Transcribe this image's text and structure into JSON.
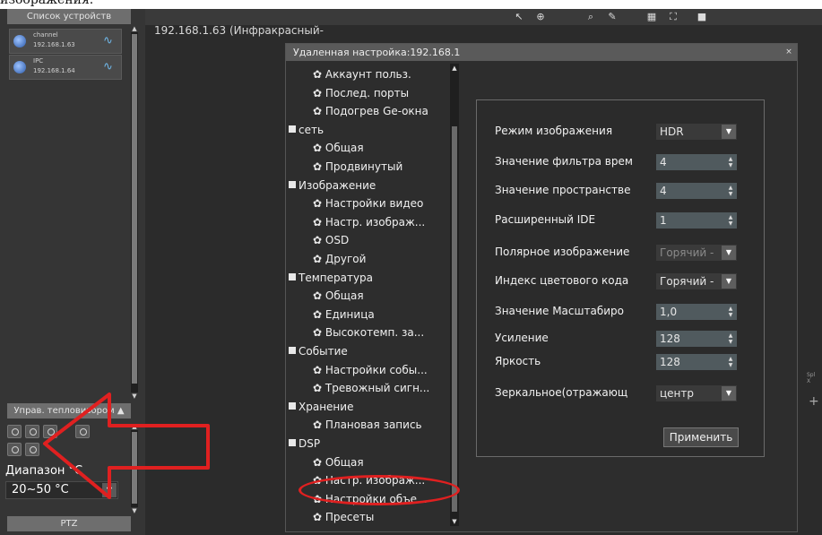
{
  "caption_fragment": "изображения.",
  "device_list": {
    "header": "Список устройств",
    "devices": [
      {
        "name": "channel",
        "ip": "192.168.1.63"
      },
      {
        "name": "IPC",
        "ip": "192.168.1.64"
      }
    ]
  },
  "thermal_panel": {
    "header": "Управ. тепловизором ▲",
    "range_label": "Диапазон °С",
    "range_value": "20~50 °С",
    "ptz_header": "PTZ"
  },
  "video": {
    "title": "192.168.1.63 (Инфракрасный-",
    "overlay_text": "Spl\nX"
  },
  "dialog": {
    "title": "Удаленная настройка:192.168.1",
    "close": "×",
    "tree": [
      {
        "label": "Аккаунт польз.",
        "level": 1
      },
      {
        "label": "Послед. порты",
        "level": 1
      },
      {
        "label": "Подогрев Ge-окна",
        "level": 1
      },
      {
        "label": "сеть",
        "level": 0
      },
      {
        "label": "Общая",
        "level": 1
      },
      {
        "label": "Продвинутый",
        "level": 1
      },
      {
        "label": "Изображение",
        "level": 0
      },
      {
        "label": "Настройки видео",
        "level": 1
      },
      {
        "label": "Настр. изображ...",
        "level": 1
      },
      {
        "label": "OSD",
        "level": 1
      },
      {
        "label": "Другой",
        "level": 1
      },
      {
        "label": "Температура",
        "level": 0
      },
      {
        "label": "Общая",
        "level": 1
      },
      {
        "label": "Единица",
        "level": 1
      },
      {
        "label": "Высокотемп. за...",
        "level": 1
      },
      {
        "label": "Событие",
        "level": 0
      },
      {
        "label": "Настройки собы...",
        "level": 1
      },
      {
        "label": "Тревожный сигн...",
        "level": 1
      },
      {
        "label": "Хранение",
        "level": 0
      },
      {
        "label": "Плановая запись",
        "level": 1
      },
      {
        "label": "DSP",
        "level": 0
      },
      {
        "label": "Общая",
        "level": 1
      },
      {
        "label": "Настр. изображ...",
        "level": 1
      },
      {
        "label": "Настройки объе...",
        "level": 1
      },
      {
        "label": "Пресеты",
        "level": 1
      }
    ],
    "form": {
      "fields": [
        {
          "label": "Режим изображения",
          "value": "HDR",
          "kind": "select"
        },
        {
          "label": "Значение фильтра врем",
          "value": "4",
          "kind": "spin"
        },
        {
          "label": "Значение пространстве",
          "value": "4",
          "kind": "spin"
        },
        {
          "label": "Расширенный IDE",
          "value": "1",
          "kind": "spin"
        },
        {
          "label": "Полярное изображение",
          "value": "Горячий -",
          "kind": "select"
        },
        {
          "label": "Индекс цветового кода",
          "value": "Горячий -",
          "kind": "select"
        },
        {
          "label": "Значение Масштабиро",
          "value": "1,0",
          "kind": "spin"
        },
        {
          "label": "Усиление",
          "value": "128",
          "kind": "spin"
        },
        {
          "label": "Яркость",
          "value": "128",
          "kind": "spin"
        },
        {
          "label": "Зеркальное(отражающ",
          "value": "центр",
          "kind": "select"
        }
      ],
      "apply_label": "Применить"
    }
  }
}
